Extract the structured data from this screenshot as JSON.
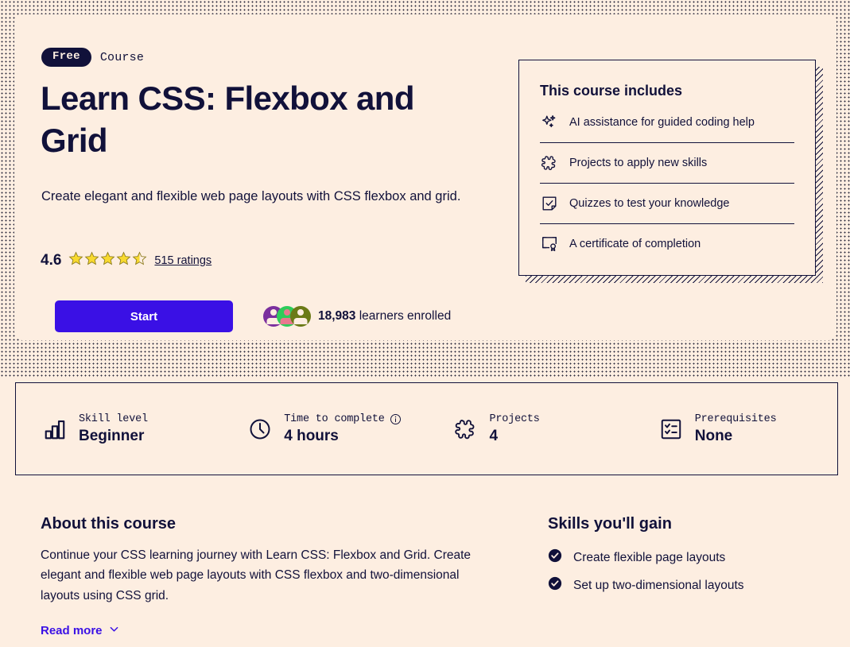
{
  "colors": {
    "page_bg": "#fdeee1",
    "ink": "#11113a",
    "accent": "#3a10e5",
    "star": "#f8d92f",
    "avatar_purple": "#7b2f9e",
    "avatar_green": "#2ecc5a",
    "avatar_olive": "#6b7a16"
  },
  "hero": {
    "badge": "Free",
    "kind": "Course",
    "title": "Learn CSS: Flexbox and Grid",
    "description": "Create elegant and flexible web page layouts with CSS flexbox and grid.",
    "rating_value": "4.6",
    "stars_filled": 4,
    "stars_half": 1,
    "stars_total": 5,
    "ratings_link": "515 ratings",
    "start_label": "Start",
    "enrolled_count": "18,983",
    "enrolled_suffix": " learners enrolled",
    "avatars": [
      "learner-avatar-purple",
      "learner-avatar-green",
      "learner-avatar-olive"
    ]
  },
  "includes": {
    "title": "This course includes",
    "items": [
      {
        "icon": "sparkles-icon",
        "label": "AI assistance for guided coding help"
      },
      {
        "icon": "puzzle-piece-icon",
        "label": "Projects to apply new skills"
      },
      {
        "icon": "quiz-checkmark-icon",
        "label": "Quizzes to test your knowledge"
      },
      {
        "icon": "certificate-icon",
        "label": "A certificate of completion"
      }
    ]
  },
  "stats": [
    {
      "icon": "bar-chart-icon",
      "label": "Skill level",
      "value": "Beginner",
      "has_info": false
    },
    {
      "icon": "clock-icon",
      "label": "Time to complete",
      "value": "4 hours",
      "has_info": true
    },
    {
      "icon": "puzzle-piece-icon",
      "label": "Projects",
      "value": "4",
      "has_info": false
    },
    {
      "icon": "checklist-icon",
      "label": "Prerequisites",
      "value": "None",
      "has_info": false
    }
  ],
  "about": {
    "title": "About this course",
    "body": "Continue your CSS learning journey with Learn CSS: Flexbox and Grid. Create elegant and flexible web page layouts with CSS flexbox and two-dimensional layouts using CSS grid.",
    "read_more": "Read more"
  },
  "skills": {
    "title": "Skills you'll gain",
    "items": [
      "Create flexible page layouts",
      "Set up two-dimensional layouts"
    ]
  }
}
